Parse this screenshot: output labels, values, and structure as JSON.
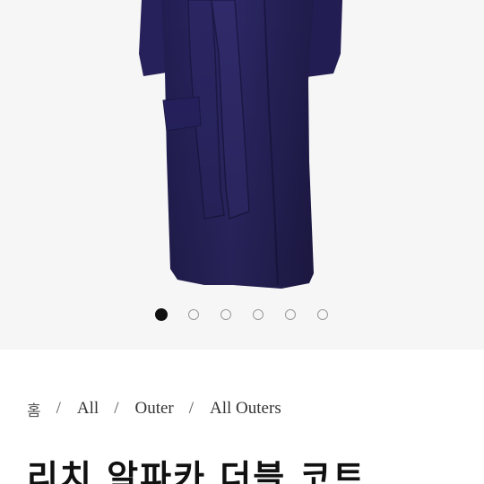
{
  "gallery": {
    "image_alt": "coat product photo",
    "slide_count": 6,
    "active_index": 0
  },
  "breadcrumb": {
    "items": [
      "홈",
      "All",
      "Outer",
      "All Outers"
    ],
    "separator": "/"
  },
  "product": {
    "title": "리치 알파카 더블 코트"
  },
  "colors": {
    "coat": "#2a2560",
    "background": "#f6f6f6",
    "dot_active": "#111111"
  }
}
